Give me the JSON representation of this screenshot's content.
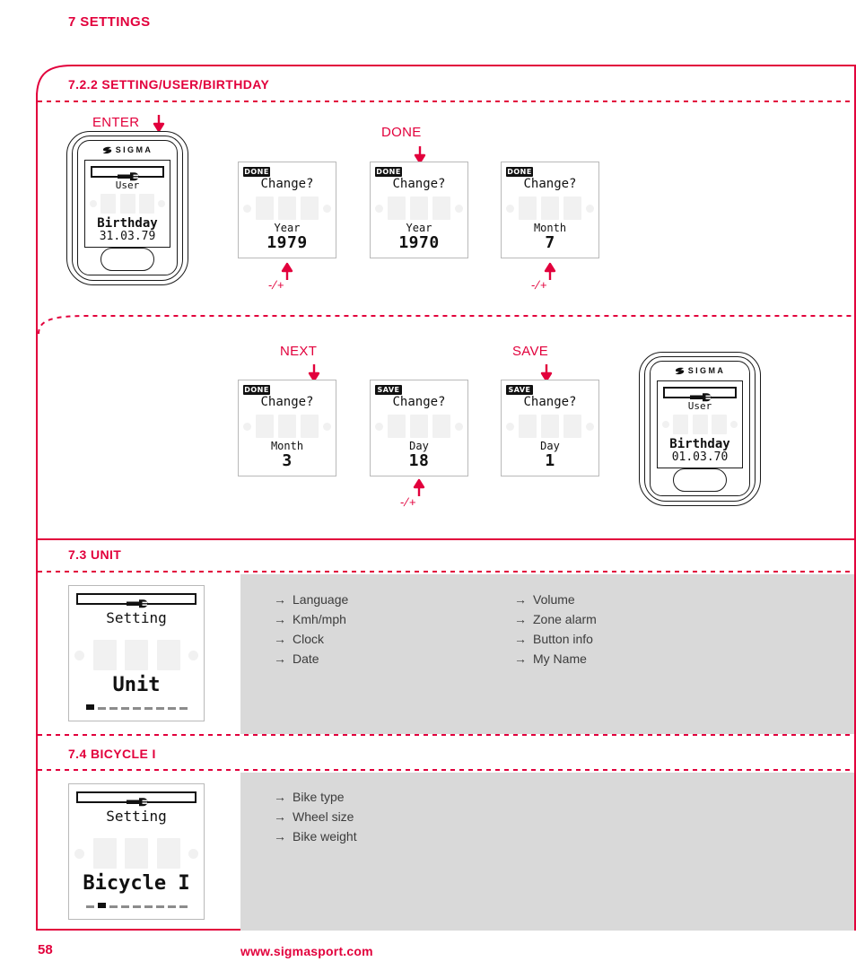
{
  "chapter": {
    "title": "7 SETTINGS"
  },
  "sections": {
    "birthday": {
      "heading": "7.2.2 SETTING/USER/BIRTHDAY",
      "row1": {
        "label_enter": "ENTER",
        "label_done": "DONE",
        "device": {
          "brand": "SIGMA",
          "sub": "User",
          "title": "Birthday",
          "value": "31.03.79"
        },
        "screens": [
          {
            "badge": "DONE",
            "question": "Change?",
            "caption": "Year",
            "value": "1979",
            "adjust": "- / +"
          },
          {
            "badge": "DONE",
            "question": "Change?",
            "caption": "Year",
            "value": "1970",
            "adjust": ""
          },
          {
            "badge": "DONE",
            "question": "Change?",
            "caption": "Month",
            "value": "7",
            "adjust": "- / +"
          }
        ]
      },
      "row2": {
        "label_next": "NEXT",
        "label_save": "SAVE",
        "screens": [
          {
            "badge": "DONE",
            "question": "Change?",
            "caption": "Month",
            "value": "3",
            "adjust": ""
          },
          {
            "badge": "SAVE",
            "question": "Change?",
            "caption": "Day",
            "value": "18",
            "adjust": "- / +"
          },
          {
            "badge": "SAVE",
            "question": "Change?",
            "caption": "Day",
            "value": "1",
            "adjust": ""
          }
        ],
        "device": {
          "brand": "SIGMA",
          "sub": "User",
          "title": "Birthday",
          "value": "01.03.70"
        }
      }
    },
    "unit": {
      "heading": "7.3 UNIT",
      "screen": {
        "sub": "Setting",
        "title": "Unit",
        "progress_index": 0,
        "progress_total": 9
      },
      "items_col1": [
        "Language",
        "Kmh/mph",
        "Clock",
        "Date"
      ],
      "items_col2": [
        "Volume",
        "Zone alarm",
        "Button info",
        "My Name"
      ]
    },
    "bicycle": {
      "heading": "7.4 BICYCLE I",
      "screen": {
        "sub": "Setting",
        "title": "Bicycle I",
        "progress_index": 1,
        "progress_total": 9
      },
      "items_col1": [
        "Bike type",
        "Wheel size",
        "Bike weight"
      ],
      "items_col2": []
    }
  },
  "footer": {
    "page": "58",
    "url": "www.sigmasport.com"
  },
  "colors": {
    "accent": "#e2003c",
    "panel": "#d9d9d9",
    "ink": "#111111"
  }
}
